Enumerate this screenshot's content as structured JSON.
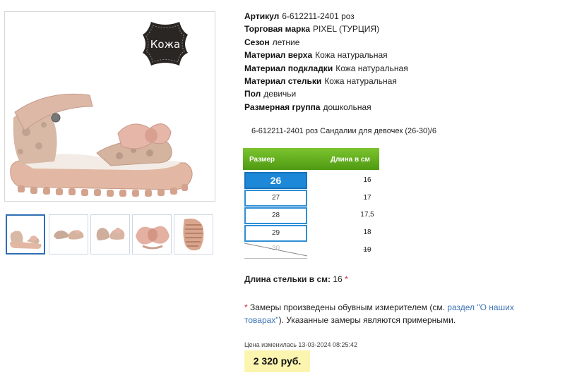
{
  "product": {
    "badge_label": "Кожа",
    "specs": [
      {
        "key": "Артикул",
        "value": "6-612211-2401 роз"
      },
      {
        "key": "Торговая марка",
        "value": "PIXEL (ТУРЦИЯ)"
      },
      {
        "key": "Сезон",
        "value": "летние"
      },
      {
        "key": "Материал верха",
        "value": "Кожа натуральная"
      },
      {
        "key": "Материал подкладки",
        "value": "Кожа натуральная"
      },
      {
        "key": "Материал стельки",
        "value": "Кожа натуральная"
      },
      {
        "key": "Пол",
        "value": "девичьи"
      },
      {
        "key": "Размерная группа",
        "value": "дошкольная"
      }
    ],
    "subtitle": "6-612211-2401 роз Сандалии для девочек (26-30)/6"
  },
  "size_table": {
    "header_size": "Размер",
    "header_length": "Длина в см",
    "rows": [
      {
        "size": "26",
        "length": "16"
      },
      {
        "size": "27",
        "length": "17"
      },
      {
        "size": "28",
        "length": "17,5"
      },
      {
        "size": "29",
        "length": "18"
      },
      {
        "size": "30",
        "length": "19"
      }
    ]
  },
  "insole": {
    "label": "Длина стельки в см:",
    "value": "16",
    "star": "*"
  },
  "note": {
    "star": "*",
    "text_before": " Замеры произведены обувным измерителем (см. ",
    "link": "раздел \"О наших товарах\"",
    "text_after": "). Указанные замеры являются примерными."
  },
  "price": {
    "changed": "Цена изменилась 13-03-2024 08:25:42",
    "value": "2 320 руб."
  },
  "colors": {
    "accent_blue": "#1e88d8",
    "header_green": "#5ea81a",
    "price_bg": "#fcf5b0"
  }
}
